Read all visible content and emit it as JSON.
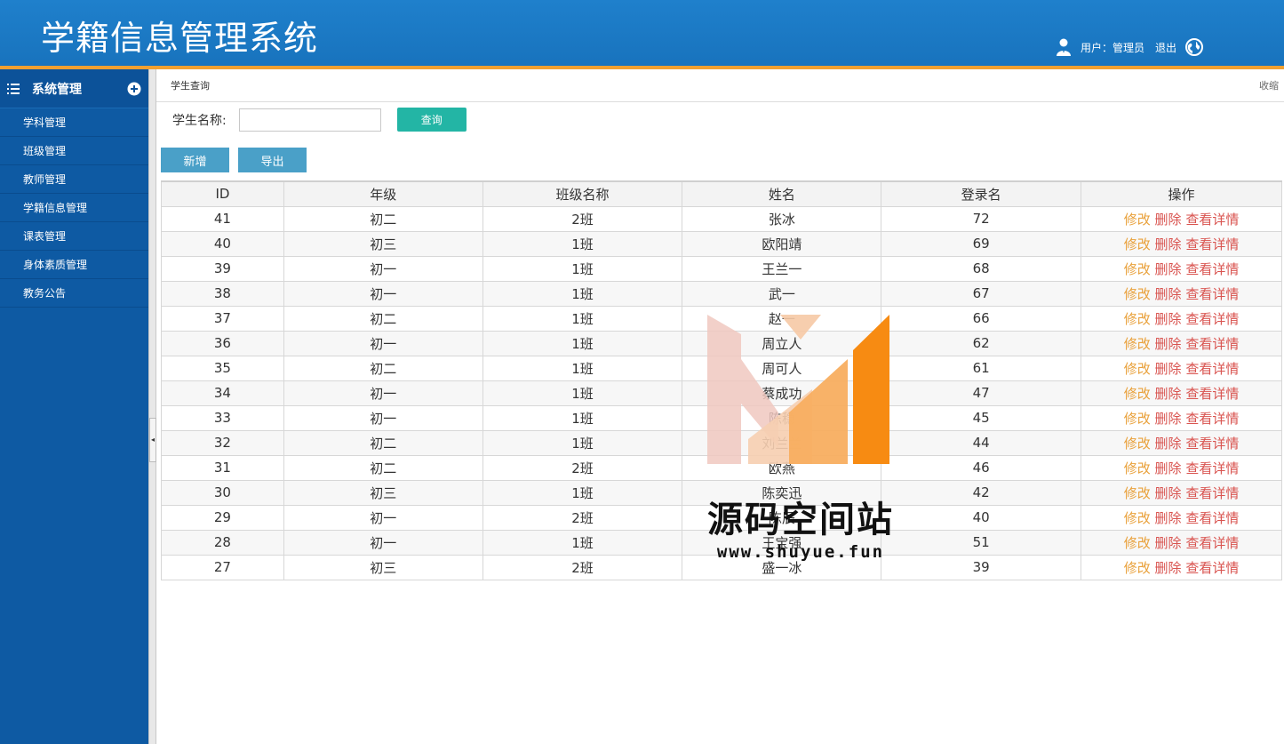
{
  "app": {
    "title": "学籍信息管理系统"
  },
  "header": {
    "user_label": "用户：管理员",
    "logout_label": "退出"
  },
  "sidebar": {
    "title": "系统管理",
    "items": [
      {
        "label": "学科管理"
      },
      {
        "label": "班级管理"
      },
      {
        "label": "教师管理"
      },
      {
        "label": "学籍信息管理"
      },
      {
        "label": "课表管理"
      },
      {
        "label": "身体素质管理"
      },
      {
        "label": "教务公告"
      }
    ]
  },
  "page": {
    "breadcrumb": "学生查询",
    "collapse_label": "收缩"
  },
  "search": {
    "label": "学生名称:",
    "value": "",
    "query_label": "查询"
  },
  "toolbar": {
    "add_label": "新增",
    "export_label": "导出"
  },
  "table": {
    "headers": [
      "ID",
      "年级",
      "班级名称",
      "姓名",
      "登录名",
      "操作"
    ],
    "actions": {
      "edit": "修改",
      "delete": "删除",
      "view": "查看详情"
    },
    "rows": [
      {
        "id": "41",
        "grade": "初二",
        "class": "2班",
        "name": "张冰",
        "login": "72"
      },
      {
        "id": "40",
        "grade": "初三",
        "class": "1班",
        "name": "欧阳靖",
        "login": "69"
      },
      {
        "id": "39",
        "grade": "初一",
        "class": "1班",
        "name": "王兰一",
        "login": "68"
      },
      {
        "id": "38",
        "grade": "初一",
        "class": "1班",
        "name": "武一",
        "login": "67"
      },
      {
        "id": "37",
        "grade": "初二",
        "class": "1班",
        "name": "赵一",
        "login": "66"
      },
      {
        "id": "36",
        "grade": "初一",
        "class": "1班",
        "name": "周立人",
        "login": "62"
      },
      {
        "id": "35",
        "grade": "初二",
        "class": "1班",
        "name": "周可人",
        "login": "61"
      },
      {
        "id": "34",
        "grade": "初一",
        "class": "1班",
        "name": "蔡成功",
        "login": "47"
      },
      {
        "id": "33",
        "grade": "初一",
        "class": "1班",
        "name": "陈稳",
        "login": "45"
      },
      {
        "id": "32",
        "grade": "初二",
        "class": "1班",
        "name": "刘兰兰",
        "login": "44"
      },
      {
        "id": "31",
        "grade": "初二",
        "class": "2班",
        "name": "欧燕",
        "login": "46"
      },
      {
        "id": "30",
        "grade": "初三",
        "class": "1班",
        "name": "陈奕迅",
        "login": "42"
      },
      {
        "id": "29",
        "grade": "初一",
        "class": "2班",
        "name": "陈辰",
        "login": "40"
      },
      {
        "id": "28",
        "grade": "初一",
        "class": "1班",
        "name": "王宝强",
        "login": "51"
      },
      {
        "id": "27",
        "grade": "初三",
        "class": "2班",
        "name": "盛一冰",
        "login": "39"
      }
    ]
  },
  "watermark": {
    "text": "源码空间站",
    "url": "www.shuyue.fun"
  },
  "colors": {
    "header": "#1873bd",
    "accent_line": "#f0a030",
    "sidebar": "#0e5aa3",
    "query_button": "#23b5a5",
    "action_button": "#4aa0c8",
    "edit": "#e9a13b",
    "delete": "#d9534f"
  }
}
